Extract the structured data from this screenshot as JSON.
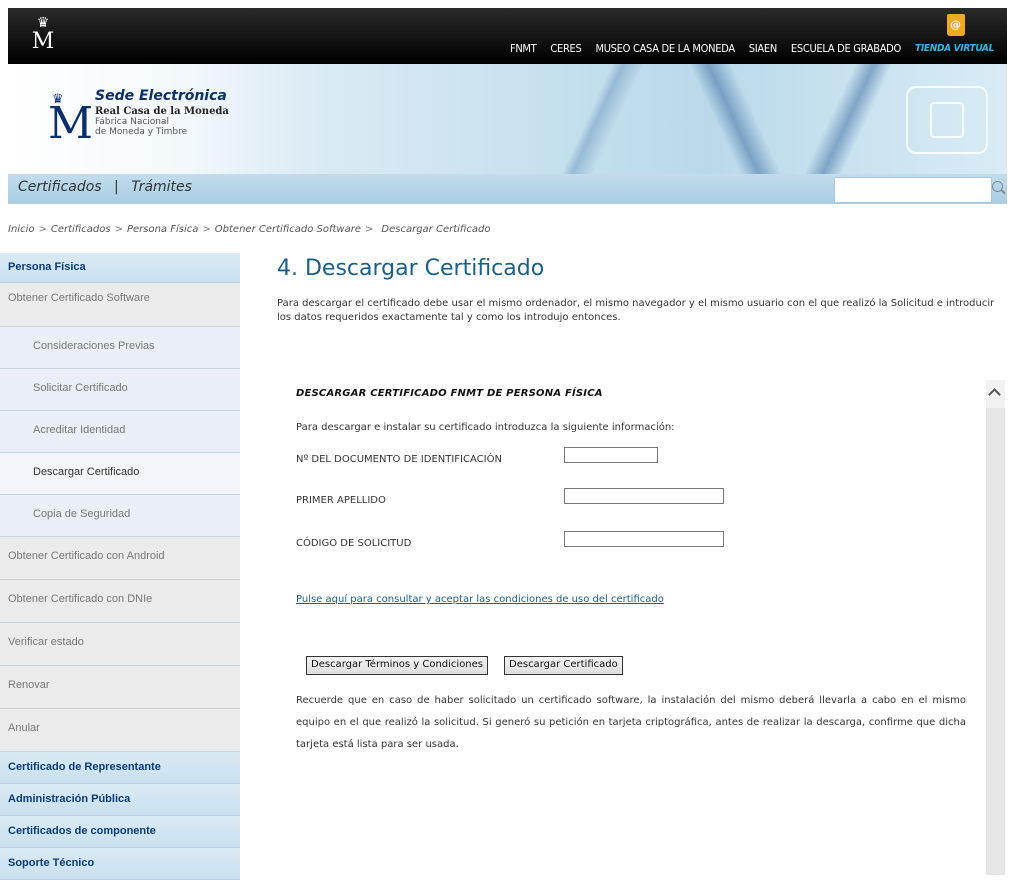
{
  "topbar": {
    "links": [
      "FNMT",
      "CERES",
      "MUSEO CASA DE LA MONEDA",
      "SIAEN",
      "ESCUELA DE GRABADO"
    ],
    "tienda": "TIENDA VIRTUAL"
  },
  "brand": {
    "title": "Sede Electrónica",
    "subtitle": "Real Casa de la Moneda",
    "line1": "Fábrica Nacional",
    "line2": "de Moneda y Timbre"
  },
  "nav2": {
    "certificados": "Certificados",
    "separator": "|",
    "tramites": "Trámites",
    "search_value": ""
  },
  "breadcrumb": {
    "items": [
      "Inicio",
      "Certificados",
      "Persona Física",
      "Obtener Certificado Software",
      "Descargar Certificado"
    ],
    "sep": ">"
  },
  "sidebar": {
    "persona_fisica": "Persona Física",
    "obtener_software": "Obtener Certificado Software",
    "consideraciones": "Consideraciones Previas",
    "solicitar": "Solicitar Certificado",
    "acreditar": "Acreditar Identidad",
    "descargar": "Descargar Certificado",
    "copia": "Copia de Seguridad",
    "android": "Obtener Certificado con Android",
    "dnie": "Obtener Certificado con DNIe",
    "verificar": "Verificar estado",
    "renovar": "Renovar",
    "anular": "Anular",
    "representante": "Certificado de Representante",
    "administracion": "Administración Pública",
    "componente": "Certificados de componente",
    "soporte": "Soporte Técnico"
  },
  "main": {
    "title": "4. Descargar Certificado",
    "intro": "Para descargar el certificado debe usar el mismo ordenador, el mismo navegador y el mismo usuario con el que realizó la Solicitud e introducir los datos requeridos exactamente tal y como los introdujo entonces."
  },
  "panel": {
    "title": "DESCARGAR CERTIFICADO FNMT DE PERSONA FÍSICA",
    "lead": "Para descargar e instalar su certificado introduzca la siguiente información:",
    "doc_label": "Nº DEL DOCUMENTO DE IDENTIFICACIÓN",
    "apellido_label": "PRIMER APELLIDO",
    "codigo_label": "CÓDIGO DE SOLICITUD",
    "doc_value": "",
    "apellido_value": "",
    "codigo_value": "",
    "conditions_link": "Pulse aquí para consultar y aceptar las condiciones de uso del certificado",
    "btn_terms": "Descargar Términos y Condiciones",
    "btn_download": "Descargar Certificado",
    "note": "Recuerde que en caso de haber solicitado un certificado software, la instalación del mismo deberá llevarla a cabo en el mismo equipo en el que realizó la solicitud. Si generó su petición en tarjeta criptográfica, antes de realizar la descarga, confirme que dicha tarjeta está lista para ser usada."
  }
}
